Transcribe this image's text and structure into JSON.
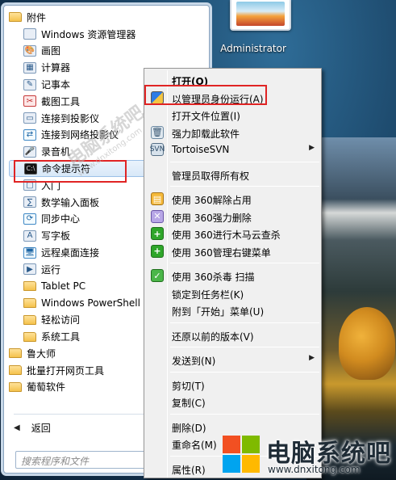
{
  "user": {
    "name": "Administrator"
  },
  "programs": [
    {
      "label": "附件",
      "type": "folder-open",
      "icon": "folder-icon"
    },
    {
      "label": "Windows 资源管理器",
      "type": "app",
      "icon": "folder-icon"
    },
    {
      "label": "画图",
      "type": "app",
      "icon": "paint-icon"
    },
    {
      "label": "计算器",
      "type": "app",
      "icon": "calculator-icon"
    },
    {
      "label": "记事本",
      "type": "app",
      "icon": "notepad-icon"
    },
    {
      "label": "截图工具",
      "type": "app",
      "icon": "scissors-icon"
    },
    {
      "label": "连接到投影仪",
      "type": "app",
      "icon": "projector-icon"
    },
    {
      "label": "连接到网络投影仪",
      "type": "app",
      "icon": "network-projector-icon"
    },
    {
      "label": "录音机",
      "type": "app",
      "icon": "microphone-icon"
    },
    {
      "label": "命令提示符",
      "type": "app",
      "icon": "command-prompt-icon",
      "selected": true
    },
    {
      "label": "入门",
      "type": "app",
      "icon": "getting-started-icon"
    },
    {
      "label": "数学输入面板",
      "type": "app",
      "icon": "math-input-icon"
    },
    {
      "label": "同步中心",
      "type": "app",
      "icon": "sync-icon"
    },
    {
      "label": "写字板",
      "type": "app",
      "icon": "wordpad-icon"
    },
    {
      "label": "远程桌面连接",
      "type": "app",
      "icon": "remote-desktop-icon"
    },
    {
      "label": "运行",
      "type": "app",
      "icon": "run-icon"
    },
    {
      "label": "Tablet PC",
      "type": "folder",
      "icon": "folder-icon"
    },
    {
      "label": "Windows PowerShell",
      "type": "folder",
      "icon": "folder-icon"
    },
    {
      "label": "轻松访问",
      "type": "folder",
      "icon": "folder-icon"
    },
    {
      "label": "系统工具",
      "type": "folder",
      "icon": "folder-icon"
    },
    {
      "label": "鲁大师",
      "type": "folder",
      "icon": "folder-icon"
    },
    {
      "label": "批量打开网页工具",
      "type": "folder",
      "icon": "folder-icon"
    },
    {
      "label": "葡萄软件",
      "type": "folder",
      "icon": "folder-icon"
    }
  ],
  "back_label": "返回",
  "search": {
    "placeholder": "搜索程序和文件"
  },
  "context_menu": [
    {
      "label": "打开(O)",
      "bold": true,
      "icon": ""
    },
    {
      "label": "以管理员身份运行(A)",
      "icon": "uac-shield-icon",
      "highlight": true
    },
    {
      "label": "打开文件位置(I)",
      "icon": ""
    },
    {
      "label": "强力卸载此软件",
      "icon": "trash-icon"
    },
    {
      "label": "TortoiseSVN",
      "icon": "tortoisesvn-icon",
      "submenu": true
    },
    {
      "sep": true
    },
    {
      "label": "管理员取得所有权",
      "icon": ""
    },
    {
      "sep": true
    },
    {
      "label": "使用 360解除占用",
      "icon": "360-unlock-icon"
    },
    {
      "label": "使用 360强力删除",
      "icon": "360-delete-icon"
    },
    {
      "label": "使用 360进行木马云查杀",
      "icon": "360-scan-icon"
    },
    {
      "label": "使用 360管理右键菜单",
      "icon": "360-menu-icon"
    },
    {
      "sep": true
    },
    {
      "label": "使用 360杀毒 扫描",
      "icon": "360-antivirus-icon"
    },
    {
      "label": "锁定到任务栏(K)",
      "icon": ""
    },
    {
      "label": "附到「开始」菜单(U)",
      "icon": ""
    },
    {
      "sep": true
    },
    {
      "label": "还原以前的版本(V)",
      "icon": ""
    },
    {
      "sep": true
    },
    {
      "label": "发送到(N)",
      "icon": "",
      "submenu": true
    },
    {
      "sep": true
    },
    {
      "label": "剪切(T)",
      "icon": ""
    },
    {
      "label": "复制(C)",
      "icon": ""
    },
    {
      "sep": true
    },
    {
      "label": "删除(D)",
      "icon": ""
    },
    {
      "label": "重命名(M)",
      "icon": ""
    },
    {
      "sep": true
    },
    {
      "label": "属性(R)",
      "icon": ""
    }
  ],
  "watermark": {
    "title": "电脑系统吧",
    "url": "www.dnxitong.com",
    "diagonal": "电脑系统吧",
    "diagonal_small": "www.dnxitong.com"
  },
  "colors": {
    "highlight_box": "#e02424",
    "win_logo": [
      "#f25022",
      "#7fba00",
      "#00a4ef",
      "#ffb900"
    ]
  }
}
